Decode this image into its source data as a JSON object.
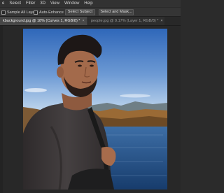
{
  "menubar": {
    "items": [
      "e",
      "Select",
      "Filter",
      "3D",
      "View",
      "Window",
      "Help"
    ]
  },
  "options": {
    "sample_all_layers": "Sample All Layers",
    "auto_enhance": "Auto-Enhance",
    "select_subject": "Select Subject",
    "select_and_mask": "Select and Mask..."
  },
  "tabs": [
    {
      "label": "kbackground.jpg @ 18% (Curves 1, RGB/8) *",
      "close": "×"
    },
    {
      "label": "people.jpg @ 9.17% (Layer 1, RGB/8) *",
      "close": "×"
    }
  ],
  "colors": {
    "sky_top": "#3b74c4",
    "sky_bottom": "#bcd6ee",
    "water": "#1f4f8a",
    "shirt": "#3a3536"
  }
}
